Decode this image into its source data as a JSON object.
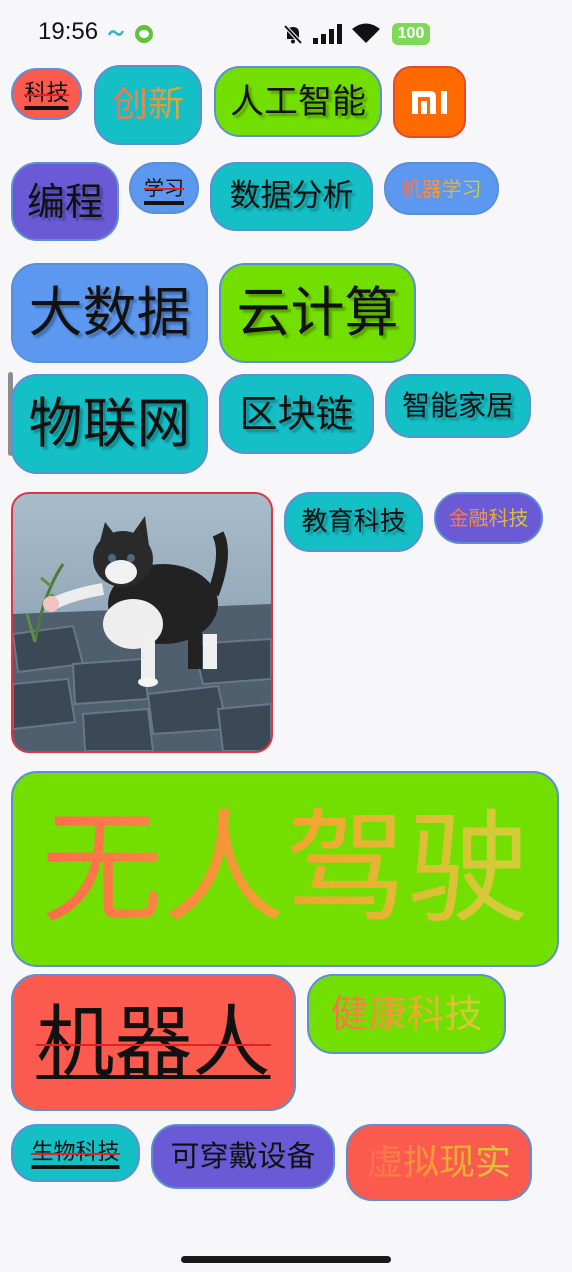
{
  "status_bar": {
    "time": "19:56",
    "battery": "100",
    "icons": [
      "clover-app-icon",
      "wechat-icon",
      "bell-off-icon",
      "signal-icon",
      "wifi-icon",
      "battery-icon"
    ]
  },
  "tags": {
    "keji": "科技",
    "chuangxin": "创新",
    "rengongzhineng": "人工智能",
    "biancheng": "编程",
    "xuexi": "学习",
    "shujufenxi": "数据分析",
    "jiqixuexi": "机器学习",
    "dashuju": "大数据",
    "yunjisuan": "云计算",
    "wulianwang": "物联网",
    "qukuailian": "区块链",
    "zhinengjiaju": "智能家居",
    "jiaoyukeji": "教育科技",
    "jinrongkeji": "金融科技",
    "wurenjiashi": "无人驾驶",
    "jiqiren": "机器人",
    "jiankangkeji": "健康科技",
    "shengwukeji": "生物科技",
    "kechuandaishebei": "可穿戴设备",
    "xunixianshi": "虚拟现实"
  },
  "colors": {
    "cyan": "#14bfc6",
    "blue": "#5c98f0",
    "green": "#73df00",
    "purple": "#6a5ad6",
    "red": "#fb5b4f",
    "border": "#5b8fd6",
    "mi_orange": "#ff6a00"
  }
}
